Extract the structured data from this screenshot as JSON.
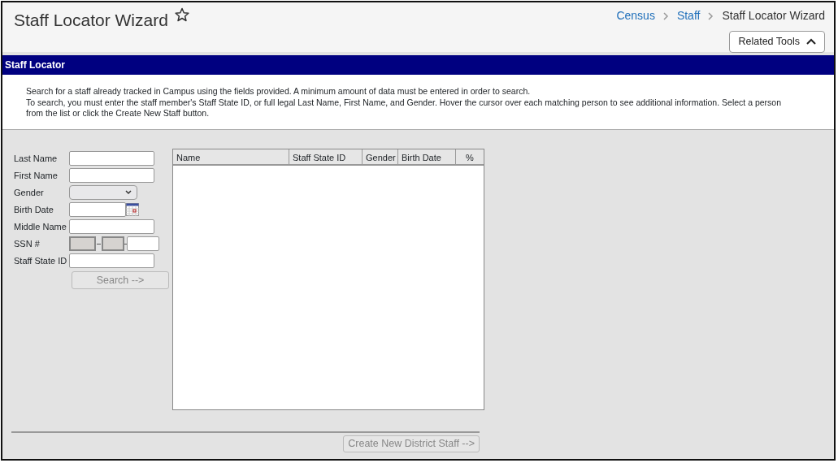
{
  "page": {
    "title": "Staff Locator Wizard",
    "favorite": false
  },
  "breadcrumbs": [
    {
      "label": "Census",
      "link": true
    },
    {
      "label": "Staff",
      "link": true
    },
    {
      "label": "Staff Locator Wizard",
      "link": false
    }
  ],
  "related_tools": {
    "label": "Related Tools",
    "expanded": true
  },
  "panel": {
    "title": "Staff Locator",
    "instructions": [
      "Search for a staff already tracked in Campus using the fields provided. A minimum amount of data must be entered in order to search.",
      "To search, you must enter the staff member's Staff State ID, or full legal Last Name, First Name, and Gender. Hover the cursor over each matching person to see additional information. Select a person from the list or click the Create New Staff button."
    ]
  },
  "fields": [
    {
      "label": "Last Name",
      "kind": "text"
    },
    {
      "label": "First Name",
      "kind": "text"
    },
    {
      "label": "Gender",
      "kind": "select"
    },
    {
      "label": "Birth Date",
      "kind": "date"
    },
    {
      "label": "Middle Name",
      "kind": "text"
    },
    {
      "label": "SSN #",
      "kind": "ssn"
    },
    {
      "label": "Staff State ID",
      "kind": "text"
    }
  ],
  "search_button": {
    "label": "Search -->",
    "disabled": true
  },
  "results": {
    "columns": [
      "Name",
      "Staff State ID",
      "Gender",
      "Birth Date",
      "%"
    ]
  },
  "create_button": {
    "label": "Create New District Staff -->",
    "disabled": true
  }
}
